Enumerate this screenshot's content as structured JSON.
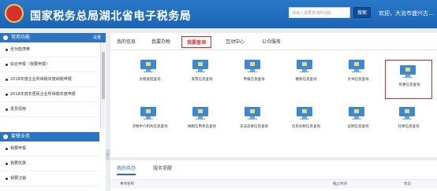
{
  "header": {
    "title": "国家税务总局湖北省电子税务局",
    "search_placeholder": "请输入需要查询的功能",
    "search_button": "搜索",
    "welcome": "欢迎，大治市盛兴古…"
  },
  "sidebar": {
    "common_title": "常用功能",
    "settings": "设置",
    "common_items": [
      "全功能搜索",
      "综合申报（我要申报）",
      "2018年度企业所得税年度纳税申报",
      "2018年度非居民企业所得税年度申报",
      "发票领用"
    ],
    "business_title": "套餐业务",
    "business_items": [
      "我要申报",
      "我要优惠",
      "我要注销"
    ]
  },
  "main": {
    "tabs": [
      "我的信息",
      "我要办税",
      "我要查询",
      "互动中心",
      "公众服务"
    ],
    "active_tab": "我要查询",
    "query_items": [
      "办税进度查询",
      "发票信息查询",
      "申报信息查询",
      "缴款信息查询",
      "文书信息查询",
      "优惠信息查询",
      "涉税中介机构信息查询",
      "纳税信用状态查询",
      "违法违章信息查询",
      "历史办税信息查询",
      "证明信息查询",
      "社保信息查询"
    ],
    "selected_item": "优惠信息查询"
  },
  "todo": {
    "tabs": [
      "我的待办",
      "服务提醒"
    ],
    "columns": [
      "事项名称",
      "截止时间",
      "状态"
    ]
  }
}
